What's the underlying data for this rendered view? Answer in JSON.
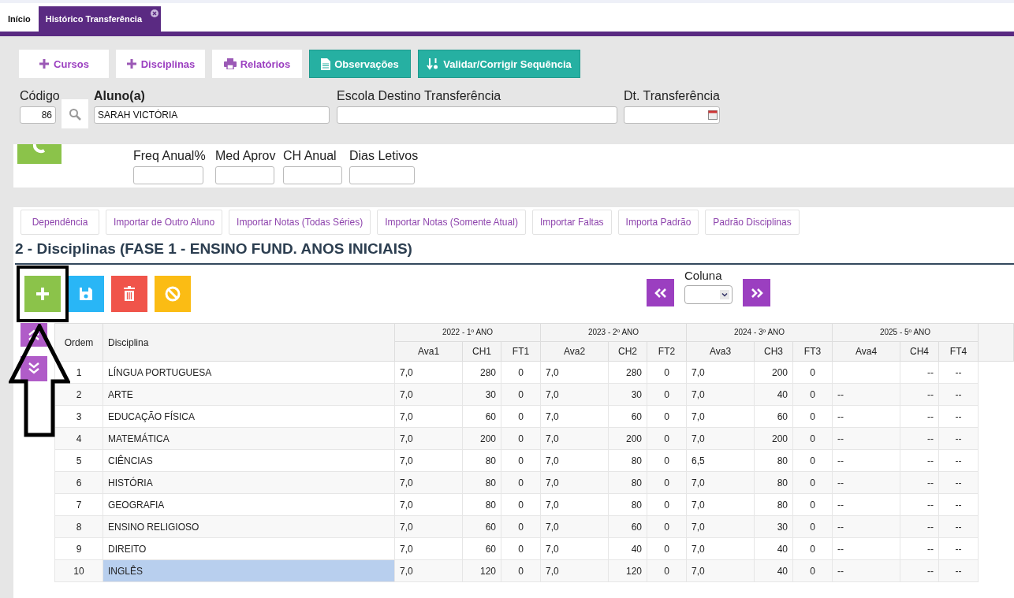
{
  "tabs": [
    {
      "label": "Início",
      "selected": false,
      "closable": false
    },
    {
      "label": "Histórico Transferência",
      "selected": true,
      "closable": true
    }
  ],
  "toolbar": [
    {
      "label": "Cursos",
      "kind": "plus"
    },
    {
      "label": "Disciplinas",
      "kind": "plus"
    },
    {
      "label": "Relatórios",
      "kind": "print"
    },
    {
      "label": "Observações",
      "kind": "doc"
    },
    {
      "label": "Validar/Corrigir Sequência",
      "kind": "sort"
    }
  ],
  "student": {
    "codigo_label": "Código",
    "codigo": "86",
    "aluno_label": "Aluno(a)",
    "aluno": "SARAH VICTÓRIA",
    "escola_label": "Escola Destino Transferência",
    "data_label": "Dt. Transferência"
  },
  "summary_fields": [
    "Freq Anual%",
    "Med Aprov",
    "CH Anual",
    "Dias Letivos"
  ],
  "subtabs": [
    "Dependência",
    "Importar de Outro Aluno",
    "Importar Notas (Todas Séries)",
    "Importar Notas (Somente Atual)",
    "Importar Faltas",
    "Importa Padrão",
    "Padrão Disciplinas"
  ],
  "section_title": "2 - Disciplinas (FASE 1 - ENSINO FUND. ANOS INICIAIS)",
  "actions": [
    {
      "kind": "add"
    },
    {
      "kind": "save"
    },
    {
      "kind": "delete"
    },
    {
      "kind": "cancel"
    }
  ],
  "column_label": "Coluna",
  "table": {
    "years": [
      "2022 - 1º ANO",
      "2023 - 2º ANO",
      "2024 - 3º ANO",
      "2025 - 5º ANO"
    ],
    "columns": [
      "Ordem",
      "Disciplina",
      "Ava1",
      "CH1",
      "FT1",
      "Ava2",
      "CH2",
      "FT2",
      "Ava3",
      "CH3",
      "FT3",
      "Ava4",
      "CH4",
      "FT4"
    ],
    "rows": [
      {
        "selected": false,
        "cells": [
          "1",
          "LÍNGUA PORTUGUESA",
          "7,0",
          "280",
          "0",
          "7,0",
          "280",
          "0",
          "7,0",
          "200",
          "0",
          "",
          "--",
          "--"
        ]
      },
      {
        "selected": false,
        "cells": [
          "2",
          "ARTE",
          "7,0",
          "30",
          "0",
          "7,0",
          "30",
          "0",
          "7,0",
          "40",
          "0",
          "--",
          "--",
          "--"
        ]
      },
      {
        "selected": false,
        "cells": [
          "3",
          "EDUCAÇÃO FÍSICA",
          "7,0",
          "60",
          "0",
          "7,0",
          "60",
          "0",
          "7,0",
          "60",
          "0",
          "--",
          "--",
          "--"
        ]
      },
      {
        "selected": false,
        "cells": [
          "4",
          "MATEMÁTICA",
          "7,0",
          "200",
          "0",
          "7,0",
          "200",
          "0",
          "7,0",
          "200",
          "0",
          "--",
          "--",
          "--"
        ]
      },
      {
        "selected": false,
        "cells": [
          "5",
          "CIÊNCIAS",
          "7,0",
          "80",
          "0",
          "7,0",
          "80",
          "0",
          "6,5",
          "80",
          "0",
          "--",
          "--",
          "--"
        ]
      },
      {
        "selected": false,
        "cells": [
          "6",
          "HISTÓRIA",
          "7,0",
          "80",
          "0",
          "7,0",
          "80",
          "0",
          "7,0",
          "80",
          "0",
          "--",
          "--",
          "--"
        ]
      },
      {
        "selected": false,
        "cells": [
          "7",
          "GEOGRAFIA",
          "7,0",
          "80",
          "0",
          "7,0",
          "80",
          "0",
          "7,0",
          "80",
          "0",
          "--",
          "--",
          "--"
        ]
      },
      {
        "selected": false,
        "cells": [
          "8",
          "ENSINO RELIGIOSO",
          "7,0",
          "60",
          "0",
          "7,0",
          "60",
          "0",
          "7,0",
          "30",
          "0",
          "--",
          "--",
          "--"
        ]
      },
      {
        "selected": false,
        "cells": [
          "9",
          "DIREITO",
          "7,0",
          "60",
          "0",
          "7,0",
          "40",
          "0",
          "7,0",
          "40",
          "0",
          "--",
          "--",
          "--"
        ]
      },
      {
        "selected": true,
        "cells": [
          "10",
          "INGLÊS",
          "7,0",
          "120",
          "0",
          "7,0",
          "120",
          "0",
          "7,0",
          "40",
          "0",
          "--",
          "--",
          "--"
        ]
      }
    ]
  }
}
